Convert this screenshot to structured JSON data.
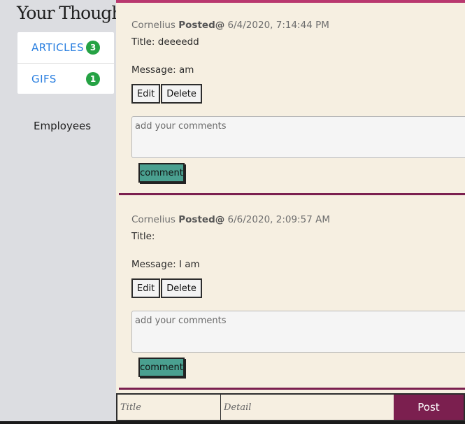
{
  "sidebar": {
    "brand": "Your Thoughts",
    "nav": [
      {
        "label": "ARTICLES",
        "count": "3"
      },
      {
        "label": "GIFS",
        "count": "1"
      }
    ],
    "employees": "Employees"
  },
  "posts": [
    {
      "author": "Cornelius",
      "posted_label": "Posted@",
      "timestamp": "6/4/2020, 7:14:44 PM",
      "title": "Title: deeeedd",
      "message": "Message: am",
      "edit_label": "Edit",
      "delete_label": "Delete",
      "comment_placeholder": "add your comments",
      "comment_label": "comment"
    },
    {
      "author": "Cornelius",
      "posted_label": "Posted@",
      "timestamp": "6/6/2020, 2:09:57 AM",
      "title": "Title:",
      "message": "Message: I am",
      "edit_label": "Edit",
      "delete_label": "Delete",
      "comment_placeholder": "add your comments",
      "comment_label": "comment"
    }
  ],
  "composer": {
    "title_placeholder": "Title",
    "detail_placeholder": "Detail",
    "post_label": "Post"
  },
  "colors": {
    "accent": "#7b1f4f",
    "top_bar": "#b9386f",
    "badge": "#25a244",
    "comment_button": "#4aa090",
    "content_bg": "#f6efe1"
  }
}
